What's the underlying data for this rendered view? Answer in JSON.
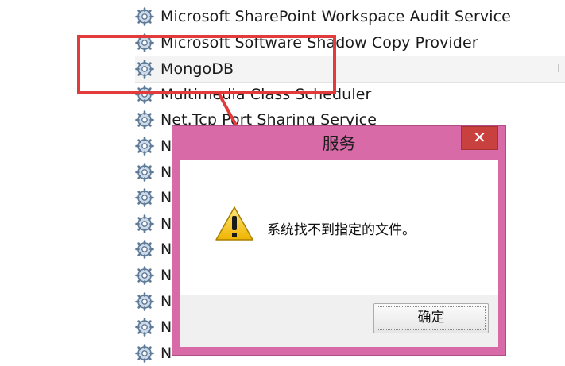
{
  "services": [
    {
      "name": "Microsoft SharePoint Workspace Audit Service",
      "selected": false
    },
    {
      "name": "Microsoft Software Shadow Copy Provider",
      "selected": false
    },
    {
      "name": "MongoDB",
      "selected": true
    },
    {
      "name": "Multimedia Class Scheduler",
      "selected": false
    },
    {
      "name": "Net.Tcp Port Sharing Service",
      "selected": false
    },
    {
      "name": "N",
      "selected": false
    },
    {
      "name": "N",
      "selected": false
    },
    {
      "name": "N",
      "selected": false
    },
    {
      "name": "N",
      "selected": false
    },
    {
      "name": "N",
      "selected": false
    },
    {
      "name": "N",
      "selected": false
    },
    {
      "name": "N",
      "selected": false
    },
    {
      "name": "N",
      "selected": false
    },
    {
      "name": "N",
      "selected": false
    }
  ],
  "dialog": {
    "title": "服务",
    "close_label": "✕",
    "message": "系统找不到指定的文件。",
    "ok_label": "确定"
  },
  "icons": {
    "service": "gear-icon",
    "warning": "warning-icon",
    "close": "close-icon"
  },
  "colors": {
    "highlight": "#e23b3b",
    "dialog_frame": "#d86aa8",
    "close_button": "#c9413f"
  }
}
